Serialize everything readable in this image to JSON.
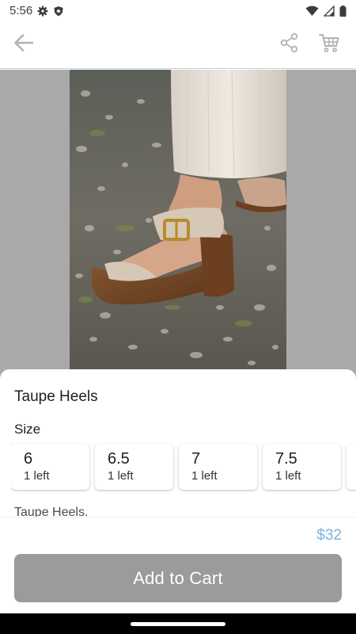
{
  "status_bar": {
    "time": "5:56",
    "icons": [
      "gear-icon",
      "shield-icon",
      "wifi-icon",
      "signal-icon",
      "battery-icon"
    ]
  },
  "app_bar": {
    "icons": [
      "back-arrow-icon",
      "share-icon",
      "cart-icon"
    ]
  },
  "product": {
    "title": "Taupe Heels",
    "size_label": "Size",
    "sizes": [
      {
        "value": "6",
        "stock": "1 left"
      },
      {
        "value": "6.5",
        "stock": "1 left"
      },
      {
        "value": "7",
        "stock": "1 left"
      },
      {
        "value": "7.5",
        "stock": "1 left"
      }
    ],
    "description": "Taupe Heels.",
    "price": "$32",
    "add_to_cart_label": "Add to Cart"
  },
  "colors": {
    "accent": "#7fb2dc",
    "button_disabled": "#9b9b9b",
    "image_background": "#a9a9a9"
  }
}
